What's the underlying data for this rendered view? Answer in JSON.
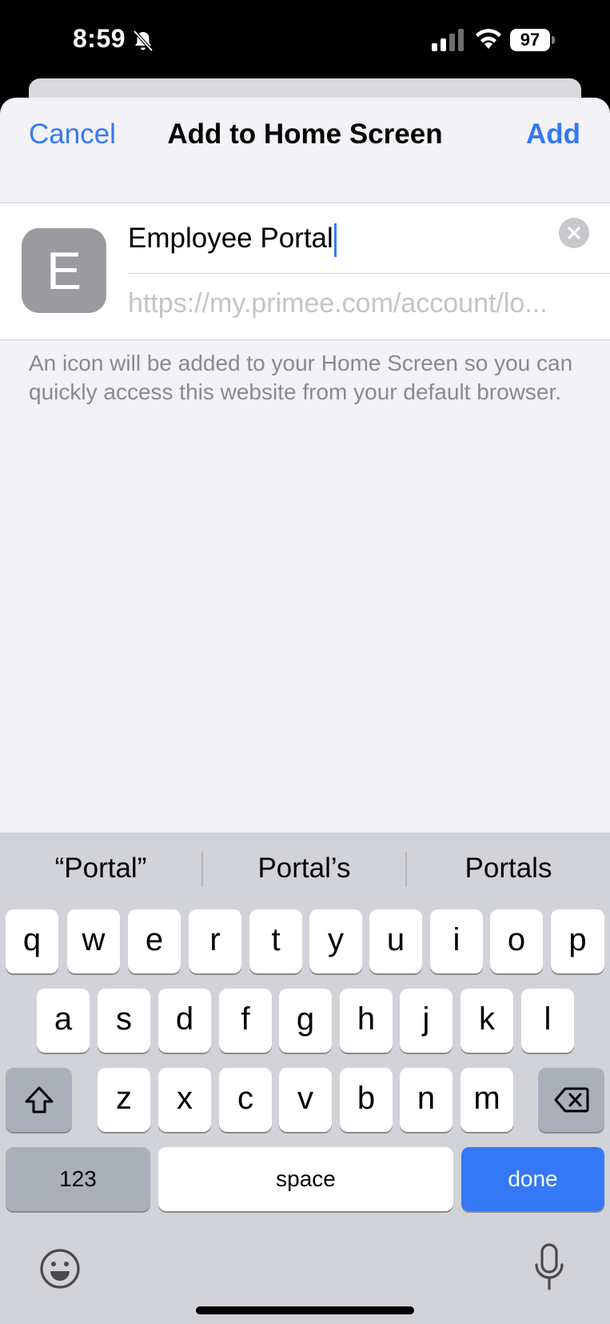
{
  "status_bar": {
    "time": "8:59",
    "battery": "97"
  },
  "nav": {
    "cancel_label": "Cancel",
    "title": "Add to Home Screen",
    "add_label": "Add"
  },
  "form": {
    "icon_letter": "E",
    "name_value": "Employee Portal",
    "url": "https://my.primee.com/account/lo..."
  },
  "note": "An icon will be added to your Home Screen so you can quickly access this website from your default browser.",
  "keyboard": {
    "suggestions": [
      "“Portal”",
      "Portal’s",
      "Portals"
    ],
    "row1": [
      "q",
      "w",
      "e",
      "r",
      "t",
      "y",
      "u",
      "i",
      "o",
      "p"
    ],
    "row2": [
      "a",
      "s",
      "d",
      "f",
      "g",
      "h",
      "j",
      "k",
      "l"
    ],
    "row3": [
      "z",
      "x",
      "c",
      "v",
      "b",
      "n",
      "m"
    ],
    "numbers_label": "123",
    "space_label": "space",
    "done_label": "done",
    "accent_color": "#3478f6"
  },
  "icons": [
    "bell-slash-icon",
    "cellular-signal-icon",
    "wifi-icon",
    "battery-icon",
    "clear-text-icon",
    "shift-icon",
    "backspace-icon",
    "emoji-icon",
    "microphone-icon"
  ]
}
